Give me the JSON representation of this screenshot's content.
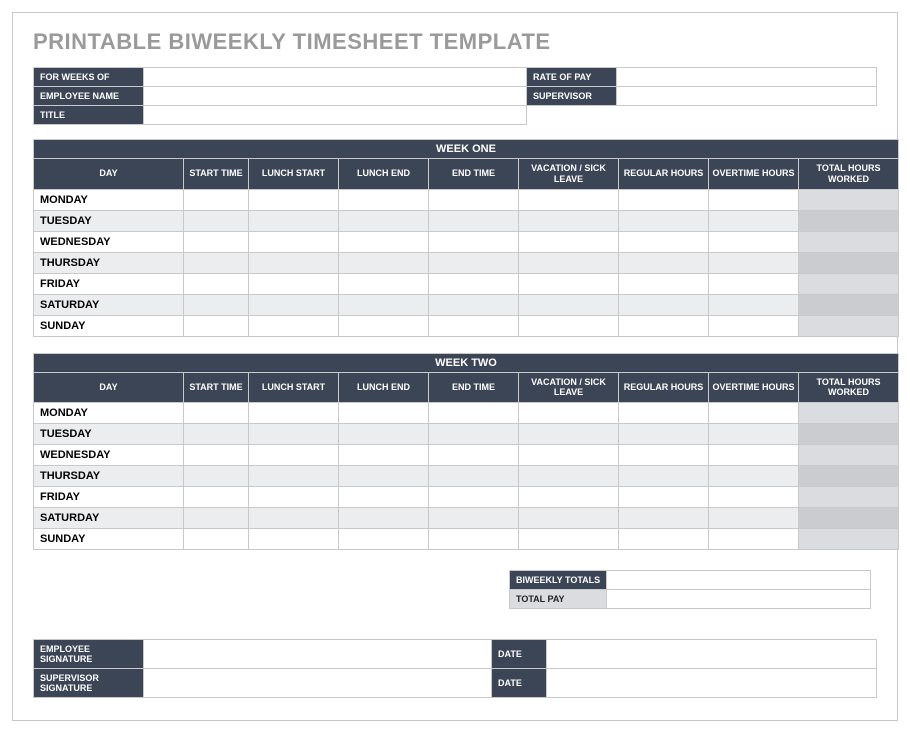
{
  "title": "PRINTABLE BIWEEKLY TIMESHEET TEMPLATE",
  "info": {
    "for_weeks_of_label": "FOR WEEKS OF",
    "for_weeks_of_value": "",
    "employee_name_label": "EMPLOYEE NAME",
    "employee_name_value": "",
    "title_label": "TITLE",
    "title_value": "",
    "rate_of_pay_label": "RATE OF PAY",
    "rate_of_pay_value": "",
    "supervisor_label": "SUPERVISOR",
    "supervisor_value": ""
  },
  "columns": {
    "day": "DAY",
    "start_time": "START TIME",
    "lunch_start": "LUNCH START",
    "lunch_end": "LUNCH END",
    "end_time": "END TIME",
    "vacation_sick": "VACATION / SICK LEAVE",
    "regular_hours": "REGULAR HOURS",
    "overtime_hours": "OVERTIME HOURS",
    "total_hours": "TOTAL HOURS WORKED"
  },
  "week_one": {
    "title": "WEEK ONE",
    "rows": [
      {
        "day": "MONDAY",
        "start": "",
        "lunch_start": "",
        "lunch_end": "",
        "end": "",
        "vac": "",
        "reg": "",
        "ot": "",
        "tot": ""
      },
      {
        "day": "TUESDAY",
        "start": "",
        "lunch_start": "",
        "lunch_end": "",
        "end": "",
        "vac": "",
        "reg": "",
        "ot": "",
        "tot": ""
      },
      {
        "day": "WEDNESDAY",
        "start": "",
        "lunch_start": "",
        "lunch_end": "",
        "end": "",
        "vac": "",
        "reg": "",
        "ot": "",
        "tot": ""
      },
      {
        "day": "THURSDAY",
        "start": "",
        "lunch_start": "",
        "lunch_end": "",
        "end": "",
        "vac": "",
        "reg": "",
        "ot": "",
        "tot": ""
      },
      {
        "day": "FRIDAY",
        "start": "",
        "lunch_start": "",
        "lunch_end": "",
        "end": "",
        "vac": "",
        "reg": "",
        "ot": "",
        "tot": ""
      },
      {
        "day": "SATURDAY",
        "start": "",
        "lunch_start": "",
        "lunch_end": "",
        "end": "",
        "vac": "",
        "reg": "",
        "ot": "",
        "tot": ""
      },
      {
        "day": "SUNDAY",
        "start": "",
        "lunch_start": "",
        "lunch_end": "",
        "end": "",
        "vac": "",
        "reg": "",
        "ot": "",
        "tot": ""
      }
    ]
  },
  "week_two": {
    "title": "WEEK TWO",
    "rows": [
      {
        "day": "MONDAY",
        "start": "",
        "lunch_start": "",
        "lunch_end": "",
        "end": "",
        "vac": "",
        "reg": "",
        "ot": "",
        "tot": ""
      },
      {
        "day": "TUESDAY",
        "start": "",
        "lunch_start": "",
        "lunch_end": "",
        "end": "",
        "vac": "",
        "reg": "",
        "ot": "",
        "tot": ""
      },
      {
        "day": "WEDNESDAY",
        "start": "",
        "lunch_start": "",
        "lunch_end": "",
        "end": "",
        "vac": "",
        "reg": "",
        "ot": "",
        "tot": ""
      },
      {
        "day": "THURSDAY",
        "start": "",
        "lunch_start": "",
        "lunch_end": "",
        "end": "",
        "vac": "",
        "reg": "",
        "ot": "",
        "tot": ""
      },
      {
        "day": "FRIDAY",
        "start": "",
        "lunch_start": "",
        "lunch_end": "",
        "end": "",
        "vac": "",
        "reg": "",
        "ot": "",
        "tot": ""
      },
      {
        "day": "SATURDAY",
        "start": "",
        "lunch_start": "",
        "lunch_end": "",
        "end": "",
        "vac": "",
        "reg": "",
        "ot": "",
        "tot": ""
      },
      {
        "day": "SUNDAY",
        "start": "",
        "lunch_start": "",
        "lunch_end": "",
        "end": "",
        "vac": "",
        "reg": "",
        "ot": "",
        "tot": ""
      }
    ]
  },
  "totals": {
    "biweekly_label": "BIWEEKLY TOTALS",
    "biweekly_value": "",
    "total_pay_label": "TOTAL PAY",
    "total_pay_value": ""
  },
  "signatures": {
    "employee_sig_label": "EMPLOYEE SIGNATURE",
    "employee_sig_value": "",
    "employee_date_label": "DATE",
    "employee_date_value": "",
    "supervisor_sig_label": "SUPERVISOR SIGNATURE",
    "supervisor_sig_value": "",
    "supervisor_date_label": "DATE",
    "supervisor_date_value": ""
  }
}
